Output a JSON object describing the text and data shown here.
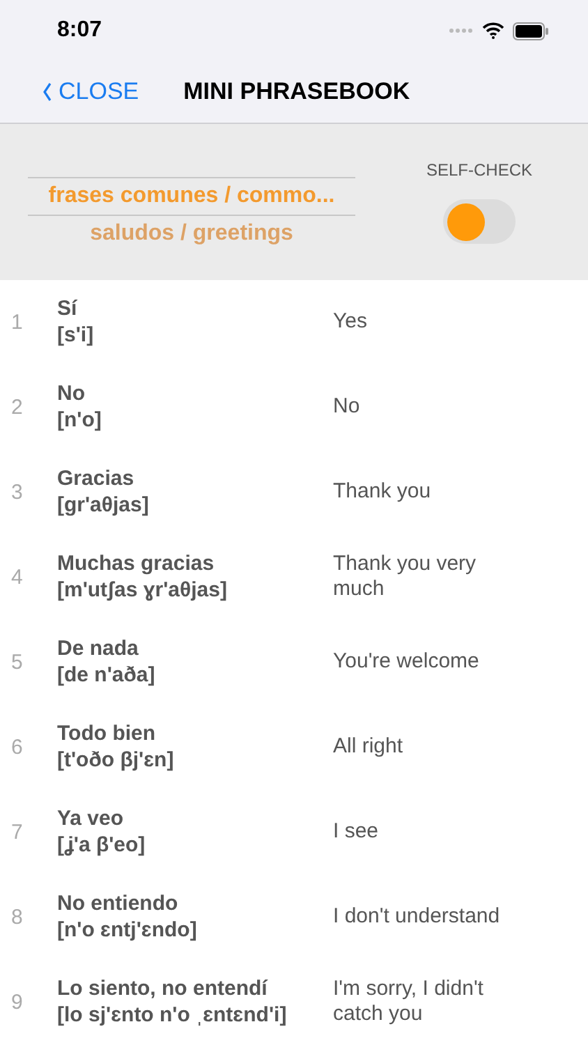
{
  "status_bar": {
    "time": "8:07"
  },
  "nav": {
    "back": "CLOSE",
    "title": "MINI PHRASEBOOK"
  },
  "picker": {
    "items": [
      {
        "label": "frases comunes / commo...",
        "selected": true
      },
      {
        "label": "saludos / greetings",
        "selected": false
      }
    ]
  },
  "self_check": {
    "label": "SELF-CHECK",
    "on": false
  },
  "phrases": [
    {
      "number": "1",
      "spanish": "Sí",
      "ipa": "[s'i]",
      "english": "Yes"
    },
    {
      "number": "2",
      "spanish": "No",
      "ipa": "[n'o]",
      "english": "No"
    },
    {
      "number": "3",
      "spanish": "Gracias",
      "ipa": "[gr'aθjas]",
      "english": "Thank you"
    },
    {
      "number": "4",
      "spanish": "Muchas gracias",
      "ipa": "[m'utʃas ɣr'aθjas]",
      "english": "Thank you very much"
    },
    {
      "number": "5",
      "spanish": "De nada",
      "ipa": "[de n'aða]",
      "english": "You're welcome"
    },
    {
      "number": "6",
      "spanish": "Todo bien",
      "ipa": "[t'oðo βj'ɛn]",
      "english": "All right"
    },
    {
      "number": "7",
      "spanish": "Ya veo",
      "ipa": "[ʝ'a β'eo]",
      "english": "I see"
    },
    {
      "number": "8",
      "spanish": "No entiendo",
      "ipa": "[n'o ɛntj'ɛndo]",
      "english": "I don't understand"
    },
    {
      "number": "9",
      "spanish": "Lo siento, no entendí",
      "ipa": "[lo sj'ɛnto n'o ˌɛntɛnd'i]",
      "english": "I'm sorry, I didn't catch you"
    }
  ]
}
